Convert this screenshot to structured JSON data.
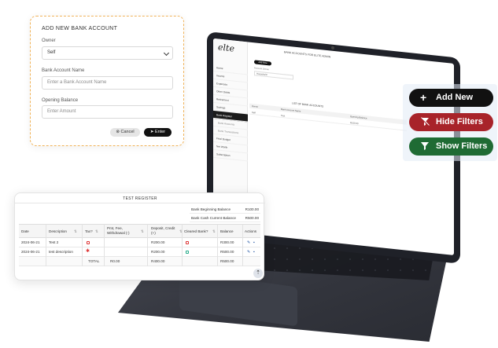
{
  "bank_form": {
    "title": "ADD NEW BANK ACCOUNT",
    "owner_label": "Owner",
    "owner_value": "Self",
    "account_name_label": "Bank Account Name",
    "account_name_placeholder": "Enter a Bank Account Name",
    "opening_balance_label": "Opening Balance",
    "opening_balance_placeholder": "Enter Amount",
    "cancel_label": "Cancel",
    "enter_label": "Enter"
  },
  "actions": {
    "add_new": "Add New",
    "hide_filters": "Hide Filters",
    "show_filters": "Show Filters",
    "colors": {
      "add_new": "#111111",
      "hide_filters": "#a8232a",
      "show_filters": "#1f6b34"
    }
  },
  "register": {
    "title": "TEST REGISTER",
    "bank_beginning_label": "Bank Beginning Balance",
    "bank_beginning_value": "R100.00",
    "bank_cash_label": "Bank Cash Current Balance",
    "bank_cash_value": "R500.00",
    "columns": [
      "Date",
      "Description",
      "Tax?",
      "Pmt, Fee, Withdrawal (-)",
      "Deposit, Credit (+)",
      "Cleared Bank?",
      "Balance",
      "Actions"
    ],
    "rows": [
      {
        "date": "2024-06-21",
        "description": "Test 2",
        "deposit": "R200.00",
        "balance": "R300.00"
      },
      {
        "date": "2024-06-21",
        "description": "test description",
        "deposit": "R200.00",
        "balance": "R500.00"
      }
    ],
    "total": {
      "label": "TOTAL",
      "withdrawal": "R0.00",
      "deposit": "R400.00",
      "balance": "R500.00"
    }
  },
  "laptop_app": {
    "logo": "elte",
    "page_title": "BANK ACCOUNTS FOR ELITE ADMIN",
    "add_new": "Add New",
    "account_owner_label": "Account Owner",
    "account_owner_value": "Household",
    "list_title": "LIST OF BANK ACCOUNTS",
    "list_columns": [
      "Owner",
      "Bank Account Name",
      "Opening Balance"
    ],
    "list_row": {
      "owner": "Self",
      "name": "Test",
      "balance": "R100.00"
    },
    "menu": [
      "Home",
      "Income",
      "Expenses",
      "Other Debts",
      "Retirement",
      "Savings",
      "Bank Register",
      "Bank Accounts",
      "Bank Transactions",
      "Final Budget",
      "Net Worth",
      "Subscription"
    ]
  }
}
